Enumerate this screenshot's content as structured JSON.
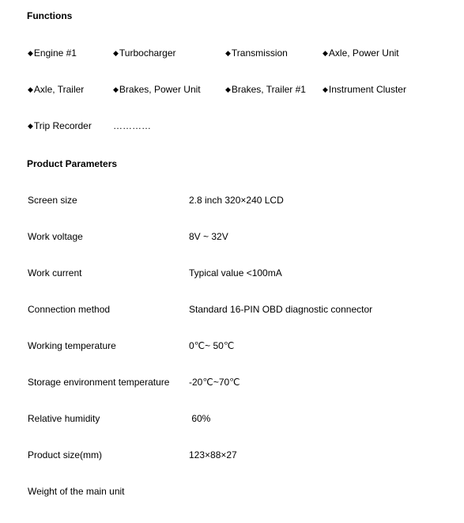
{
  "functions": {
    "heading": "Functions",
    "bullet_glyph": "◆",
    "items": [
      "Engine #1",
      "Turbocharger",
      "Transmission",
      "Axle, Power Unit",
      "Axle, Trailer",
      "Brakes, Power Unit",
      "Brakes, Trailer #1",
      "Instrument Cluster",
      "Trip Recorder"
    ],
    "ellipsis": "…………"
  },
  "parameters": {
    "heading": "Product Parameters",
    "rows": [
      {
        "label": "Screen size",
        "value": "2.8 inch  320×240  LCD"
      },
      {
        "label": "Work voltage",
        "value": "8V ~ 32V"
      },
      {
        "label": "Work current",
        "value": "Typical value <100mA"
      },
      {
        "label": "Connection method",
        "value": "Standard 16-PIN OBD diagnostic connector"
      },
      {
        "label": "Working temperature",
        "value": "0℃~ 50℃"
      },
      {
        "label": "Storage environment temperature",
        "value": "-20℃~70℃"
      },
      {
        "label": "Relative humidity",
        "value": " 60%"
      },
      {
        "label": "Product size(mm)",
        "value": "123×88×27"
      },
      {
        "label": "Weight of the main unit",
        "value": ""
      }
    ]
  }
}
